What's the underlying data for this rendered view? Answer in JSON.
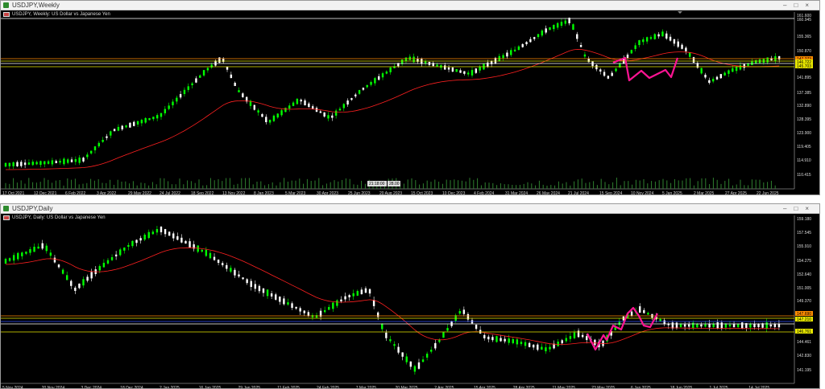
{
  "weekly": {
    "window_title": "USDJPY,Weekly",
    "chart_label": "USDJPY, Weekly:  US Dollar vs Japanese Yen",
    "price_labels": [
      "161.600",
      "160.945",
      "155.365",
      "150.870",
      "147.273",
      "146.722",
      "145.703",
      "141.895",
      "137.385",
      "132.890",
      "128.395",
      "123.900",
      "119.405",
      "114.910",
      "110.415"
    ],
    "date_labels": [
      "17 Oct 2021",
      "12 Dec 2021",
      "6 Feb 2022",
      "3 Apr 2022",
      "29 May 2022",
      "24 Jul 2022",
      "18 Sep 2022",
      "13 Nov 2022",
      "8 Jan 2023",
      "5 Mar 2023",
      "30 Apr 2023",
      "25 Jun 2023",
      "20 Aug 2023",
      "15 Oct 2023",
      "10 Dec 2023",
      "4 Feb 2024",
      "31 Mar 2024",
      "26 May 2024",
      "21 Jul 2024",
      "15 Sep 2024",
      "10 Nov 2024",
      "5 Jan 2025",
      "2 Mar 2025",
      "27 Apr 2025",
      "22 Jun 2025"
    ],
    "crosshair_label": "21:18:00",
    "crosshair_value": "28.00"
  },
  "daily": {
    "window_title": "USDJPY,Daily",
    "chart_label": "USDJPY, Daily:  US Dollar vs Japanese Yen",
    "price_labels": [
      "159.180",
      "157.545",
      "155.910",
      "154.275",
      "152.640",
      "151.005",
      "149.370",
      "147.690",
      "147.210",
      "146.761",
      "144.461",
      "142.830",
      "141.195"
    ],
    "date_labels": [
      "5 Nov 2024",
      "20 Nov 2024",
      "3 Dec 2024",
      "18 Dec 2024",
      "2 Jan 2025",
      "16 Jan 2025",
      "29 Jan 2025",
      "11 Feb 2025",
      "24 Feb 2025",
      "7 Mar 2025",
      "20 Mar 2025",
      "2 Apr 2025",
      "15 Apr 2025",
      "28 Apr 2025",
      "11 May 2025",
      "23 May 2025",
      "6 Jun 2025",
      "18 Jun 2025",
      "1 Jul 2025",
      "14 Jul 2025"
    ]
  },
  "colors": {
    "background": "#000000",
    "bull_candle": "#00ff00",
    "bear_candle": "#ffffff",
    "moving_average": "#ff2020",
    "pattern_line": "#ff1493",
    "level_orange": "#ff8c00",
    "level_yellow": "#e8e800",
    "level_blue": "#3050ff",
    "level_white": "#ffffff"
  },
  "window_buttons": [
    "–",
    "□",
    "×"
  ]
}
